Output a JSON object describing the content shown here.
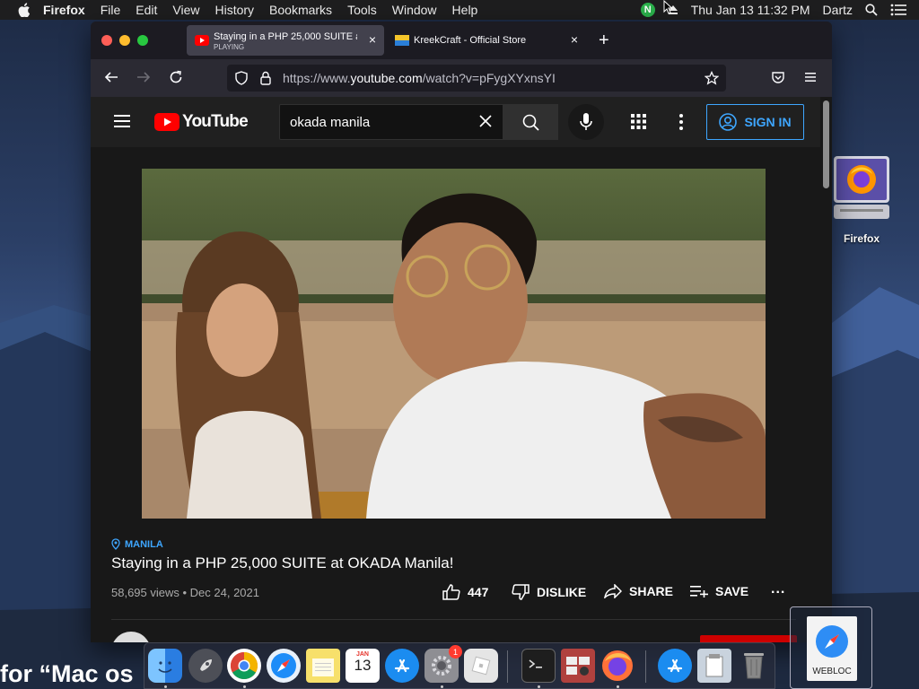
{
  "menubar": {
    "items": [
      "Firefox",
      "File",
      "Edit",
      "View",
      "History",
      "Bookmarks",
      "Tools",
      "Window",
      "Help"
    ],
    "clock": "Thu Jan 13  11:32 PM",
    "user": "Dartz",
    "n_icon_letter": "N"
  },
  "browser": {
    "tabs": [
      {
        "title": "Staying in a PHP 25,000 SUITE at OKADA Manila!",
        "subtitle": "PLAYING",
        "close": "×"
      },
      {
        "title": "KreekCraft - Official Store",
        "close": "×"
      }
    ],
    "new_tab": "+",
    "url": {
      "prefix": "https://www.",
      "domain": "youtube.com",
      "path": "/watch?v=pFygXYxnsYI"
    }
  },
  "youtube": {
    "logo_text": "YouTube",
    "search_value": "okada manila",
    "sign_in": "SIGN IN",
    "video": {
      "location": "MANILA",
      "title": "Staying in a PHP 25,000 SUITE at OKADA Manila!",
      "meta": "58,695 views • Dec 24, 2021",
      "likes": "447",
      "dislike": "DISLIKE",
      "share": "SHARE",
      "save": "SAVE",
      "more": "..."
    }
  },
  "desktop": {
    "firefox_icon_label": "Firefox",
    "webloc_label": "WEBLOC",
    "background_text": "for “Mac os"
  },
  "dock": {
    "calendar_month": "JAN",
    "calendar_day": "13",
    "system_prefs_badge": "1"
  },
  "colors": {
    "accent_blue": "#3ea6ff",
    "youtube_red": "#ff0000",
    "yt_background": "#181818"
  }
}
